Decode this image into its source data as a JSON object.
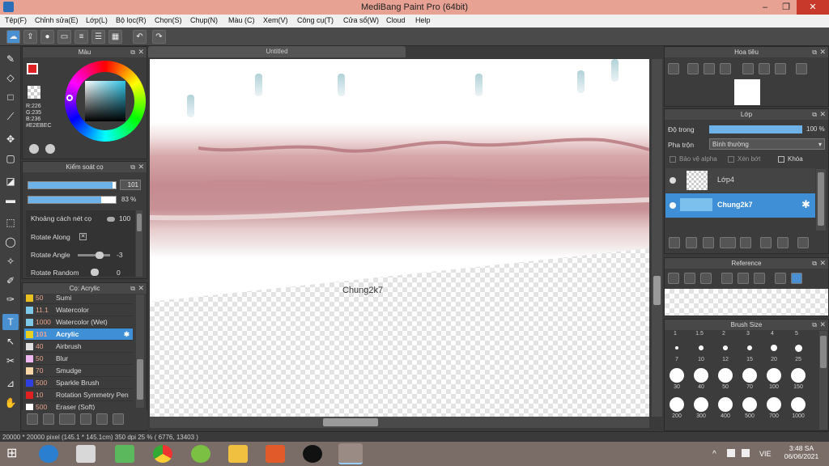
{
  "window": {
    "title": "MediBang Paint Pro (64bit)",
    "minimize": "–",
    "maximize": "❐",
    "close": "✕"
  },
  "menu": [
    "Tệp(F)",
    "Chỉnh sửa(E)",
    "Lớp(L)",
    "Bộ lọc(R)",
    "Chọn(S)",
    "Chụp(N)",
    "Màu (C)",
    "Xem(V)",
    "Công cụ(T)",
    "Cửa sổ(W)",
    "Cloud",
    "Help"
  ],
  "color_panel": {
    "title": "Màu",
    "r": "R:226",
    "g": "G:235",
    "b": "B:236",
    "hex": "#E2EBEC"
  },
  "brush_control": {
    "title": "Kiểm soát cọ",
    "size_value": "101",
    "opacity_value": "83 %",
    "opacity_fraction": 0.83,
    "spacing_label": "Khoảng cách nét cọ",
    "spacing_value": "100",
    "rotate_along_label": "Rotate Along",
    "rotate_angle_label": "Rotate Angle",
    "rotate_angle_value": "-3",
    "rotate_random_label": "Rotate Random",
    "rotate_random_value": "0"
  },
  "brush_list": {
    "title": "Cọ: Acrylic",
    "items": [
      {
        "size": "50",
        "name": "Sumi",
        "color": "#e8c020"
      },
      {
        "size": "11.1",
        "name": "Watercolor",
        "color": "#7ec8e8"
      },
      {
        "size": "1000",
        "name": "Watercolor (Wet)",
        "color": "#7ec8e8"
      },
      {
        "size": "101",
        "name": "Acrylic",
        "color": "#e8d020"
      },
      {
        "size": "40",
        "name": "Airbrush",
        "color": "#e0e0e0"
      },
      {
        "size": "50",
        "name": "Blur",
        "color": "#f0b8f0"
      },
      {
        "size": "70",
        "name": "Smudge",
        "color": "#f8d8a8"
      },
      {
        "size": "500",
        "name": "Sparkle Brush",
        "color": "#3040e0"
      },
      {
        "size": "10",
        "name": "Rotation Symmetry Pen",
        "color": "#e02020"
      },
      {
        "size": "500",
        "name": "Eraser (Soft)",
        "color": "#ffffff"
      }
    ],
    "selected_index": 3
  },
  "canvas": {
    "tab_title": "Untitled",
    "watermark": "Chung2k7"
  },
  "status_bar": {
    "text": "20000 * 20000 pixel   (145.1 * 145.1cm)   350 dpi   25 %   ( 6776, 13403 )"
  },
  "navigator": {
    "title": "Hoa tiêu"
  },
  "layers": {
    "title": "Lớp",
    "opacity_label": "Độ trong",
    "opacity_value": "100 %",
    "opacity_fraction": 1.0,
    "blend_label": "Pha trộn",
    "blend_value": "Bình thường",
    "protect_alpha": "Bảo vệ alpha",
    "clipping": "Xén bớt",
    "lock": "Khóa",
    "items": [
      {
        "name": "Lớp4",
        "selected": false
      },
      {
        "name": "Chung2k7",
        "selected": true
      }
    ]
  },
  "reference": {
    "title": "Reference"
  },
  "brush_size": {
    "title": "Brush Size",
    "headers": [
      "1",
      "1.5",
      "2",
      "3",
      "4",
      "5"
    ],
    "row1": [
      "7",
      "10",
      "12",
      "15",
      "20",
      "25"
    ],
    "row2": [
      "30",
      "40",
      "50",
      "70",
      "100",
      "150"
    ],
    "row3": [
      "200",
      "300",
      "400",
      "500",
      "700",
      "1000"
    ]
  },
  "taskbar": {
    "lang": "VIE",
    "time": "3:48 SA",
    "date": "06/06/2021"
  }
}
